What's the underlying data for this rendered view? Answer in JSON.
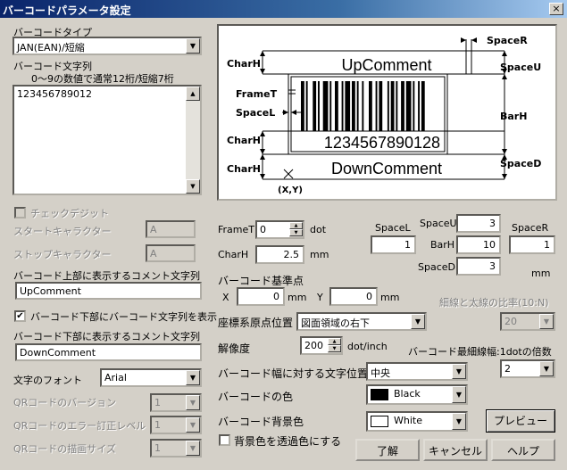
{
  "window": {
    "title": "バーコードパラメータ設定",
    "close": "×"
  },
  "left": {
    "barcode_type_label": "バーコードタイプ",
    "barcode_type_value": "JAN(EAN)/短縮",
    "barcode_string_label": "バーコード文字列",
    "barcode_string_hint": "0～9の数値で通常12桁/短縮7桁",
    "barcode_string_value": "123456789012",
    "check_digit_label": "チェックデジット",
    "start_char_label": "スタートキャラクター",
    "start_char_value": "A",
    "stop_char_label": "ストップキャラクター",
    "stop_char_value": "A",
    "upper_comment_label": "バーコード上部に表示するコメント文字列",
    "upper_comment_value": "UpComment",
    "show_lower_label": "バーコード下部にバーコード文字列を表示",
    "show_lower_checked": "✔",
    "lower_comment_label": "バーコード下部に表示するコメント文字列",
    "lower_comment_value": "DownComment",
    "font_label": "文字のフォント",
    "font_value": "Arial",
    "qr_version_label": "QRコードのバージョン",
    "qr_version_value": "1",
    "qr_error_label": "QRコードのエラー訂正レベル",
    "qr_error_value": "1",
    "qr_size_label": "QRコードの描画サイズ",
    "qr_size_value": "1"
  },
  "diagram": {
    "up_comment": "UpComment",
    "down_comment": "DownComment",
    "digits": "1234567890128",
    "labels": {
      "charh1": "CharH",
      "charh2": "CharH",
      "charh3": "CharH",
      "framet": "FrameT",
      "spacel": "SpaceL",
      "spacer": "SpaceR",
      "spaceu": "SpaceU",
      "barh": "BarH",
      "spaced": "SpaceD",
      "origin": "(X,Y)"
    }
  },
  "params": {
    "framet_label": "FrameT",
    "framet_value": "0",
    "framet_unit": "dot",
    "charh_label": "CharH",
    "charh_value": "2.5",
    "charh_unit": "mm",
    "spacel_label": "SpaceL",
    "spacel_value": "1",
    "spaceu_label": "SpaceU",
    "spaceu_value": "3",
    "barh_label": "BarH",
    "barh_value": "10",
    "spacer_label": "SpaceR",
    "spacer_value": "1",
    "spaced_label": "SpaceD",
    "spaced_value": "3",
    "space_unit": "mm",
    "base_point_label": "バーコード基準点",
    "x_label": "X",
    "x_value": "0",
    "x_unit": "mm",
    "y_label": "Y",
    "y_value": "0",
    "y_unit": "mm",
    "ratio_label": "細線と太線の比率(10:N)",
    "ratio_value": "20",
    "origin_label": "座標系原点位置",
    "origin_value": "図面領域の右下",
    "resolution_label": "解像度",
    "resolution_value": "200",
    "resolution_unit": "dot/inch",
    "min_width_label": "バーコード最細線幅:1dotの倍数",
    "min_width_value": "2",
    "text_pos_label": "バーコード幅に対する文字位置",
    "text_pos_value": "中央",
    "bar_color_label": "バーコードの色",
    "bar_color_value": "Black",
    "bar_color_hex": "#000000",
    "bg_color_label": "バーコード背景色",
    "bg_color_value": "White",
    "bg_color_hex": "#ffffff",
    "transparent_label": "背景色を透過色にする"
  },
  "buttons": {
    "preview": "プレビュー",
    "ok": "了解",
    "cancel": "キャンセル",
    "help": "ヘルプ"
  }
}
